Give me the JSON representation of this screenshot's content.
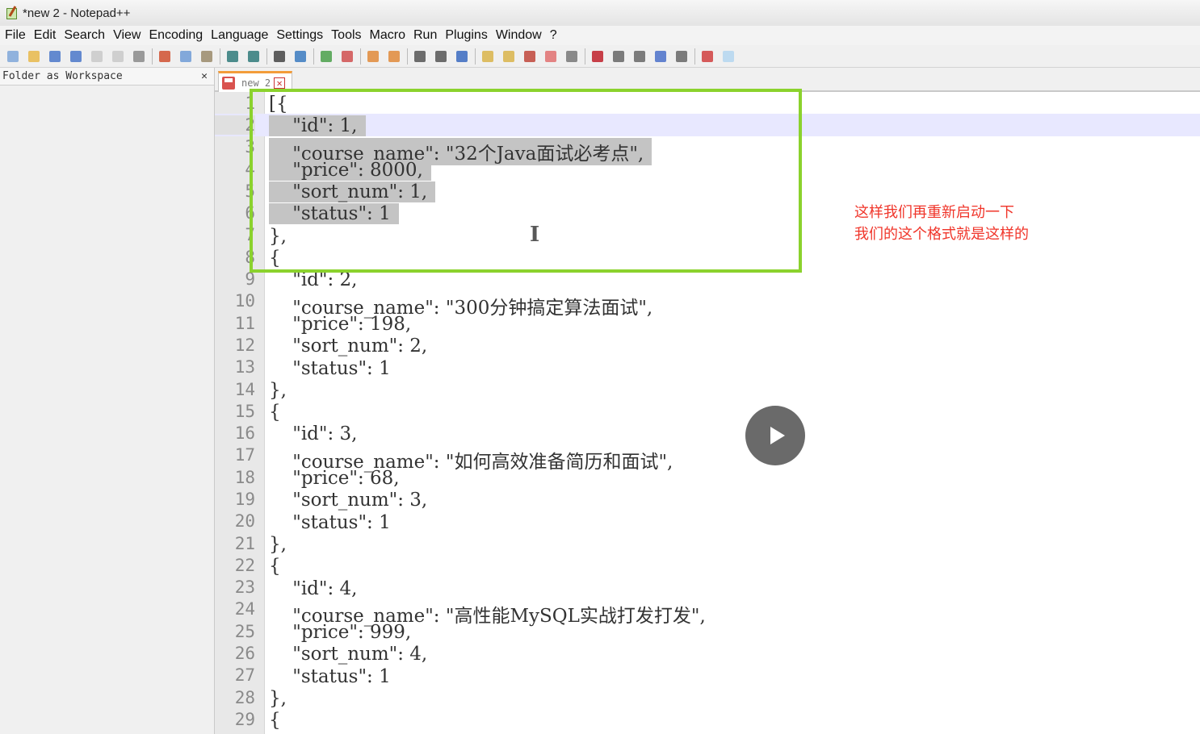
{
  "window": {
    "title": "*new 2 - Notepad++"
  },
  "menu": [
    "File",
    "Edit",
    "Search",
    "View",
    "Encoding",
    "Language",
    "Settings",
    "Tools",
    "Macro",
    "Run",
    "Plugins",
    "Window",
    "?"
  ],
  "toolbar": {
    "groups": [
      [
        "new-file-icon",
        "open-file-icon",
        "save-icon",
        "save-all-icon",
        "close-icon",
        "close-all-icon",
        "print-icon"
      ],
      [
        "cut-icon",
        "copy-icon",
        "paste-icon"
      ],
      [
        "undo-icon",
        "redo-icon"
      ],
      [
        "find-icon",
        "replace-icon"
      ],
      [
        "zoom-in-icon",
        "zoom-out-icon"
      ],
      [
        "sync-vertical-icon",
        "sync-horizontal-icon"
      ],
      [
        "word-wrap-icon",
        "show-all-chars-icon",
        "indent-guide-icon"
      ],
      [
        "user-language-icon",
        "doc-map-icon",
        "function-list-icon",
        "folder-workspace-icon",
        "monitor-icon"
      ],
      [
        "record-macro-icon",
        "stop-macro-icon",
        "play-macro-icon",
        "run-macro-multiple-icon",
        "save-macro-icon"
      ],
      [
        "spell-check-icon",
        "highlight-icon"
      ]
    ],
    "colors": [
      "#7fa7d9",
      "#e8b84a",
      "#4a77c9",
      "#4a77c9",
      "#c9c9c9",
      "#c9c9c9",
      "#8a8a8a",
      "#d05030",
      "#6f9bd6",
      "#9a8a6a",
      "#2f7a7a",
      "#2f7a7a",
      "#444444",
      "#3a7abf",
      "#4aa04a",
      "#d05050",
      "#e08a3a",
      "#e08a3a",
      "#555555",
      "#555555",
      "#3a6abf",
      "#d9b44a",
      "#d9b44a",
      "#c0453a",
      "#e07070",
      "#777777",
      "#c0202a",
      "#666666",
      "#666666",
      "#4a70c9",
      "#666666",
      "#d04040",
      "#b4d6f0"
    ]
  },
  "sidebar": {
    "title": "Folder as Workspace",
    "close": "✕"
  },
  "tab": {
    "label": "new 2",
    "close": "✕"
  },
  "editor": {
    "lines": [
      {
        "num": "1",
        "code": "[{",
        "sel": false
      },
      {
        "num": "2",
        "code": "    \"id\": 1,",
        "sel": true,
        "current": true
      },
      {
        "num": "3",
        "code": "    \"course_name\": \"32个Java面试必考点\",",
        "sel": true
      },
      {
        "num": "4",
        "code": "    \"price\": 8000,",
        "sel": true
      },
      {
        "num": "5",
        "code": "    \"sort_num\": 1,",
        "sel": true
      },
      {
        "num": "6",
        "code": "    \"status\": 1",
        "sel": true
      },
      {
        "num": "7",
        "code": "},",
        "sel": false
      },
      {
        "num": "8",
        "code": "{",
        "sel": false
      },
      {
        "num": "9",
        "code": "    \"id\": 2,",
        "sel": false
      },
      {
        "num": "10",
        "code": "    \"course_name\": \"300分钟搞定算法面试\",",
        "sel": false
      },
      {
        "num": "11",
        "code": "    \"price\": 198,",
        "sel": false
      },
      {
        "num": "12",
        "code": "    \"sort_num\": 2,",
        "sel": false
      },
      {
        "num": "13",
        "code": "    \"status\": 1",
        "sel": false
      },
      {
        "num": "14",
        "code": "},",
        "sel": false
      },
      {
        "num": "15",
        "code": "{",
        "sel": false
      },
      {
        "num": "16",
        "code": "    \"id\": 3,",
        "sel": false
      },
      {
        "num": "17",
        "code": "    \"course_name\": \"如何高效准备简历和面试\",",
        "sel": false
      },
      {
        "num": "18",
        "code": "    \"price\": 68,",
        "sel": false
      },
      {
        "num": "19",
        "code": "    \"sort_num\": 3,",
        "sel": false
      },
      {
        "num": "20",
        "code": "    \"status\": 1",
        "sel": false
      },
      {
        "num": "21",
        "code": "},",
        "sel": false
      },
      {
        "num": "22",
        "code": "{",
        "sel": false
      },
      {
        "num": "23",
        "code": "    \"id\": 4,",
        "sel": false
      },
      {
        "num": "24",
        "code": "    \"course_name\": \"高性能MySQL实战打发打发\",",
        "sel": false
      },
      {
        "num": "25",
        "code": "    \"price\": 999,",
        "sel": false
      },
      {
        "num": "26",
        "code": "    \"sort_num\": 4,",
        "sel": false
      },
      {
        "num": "27",
        "code": "    \"status\": 1",
        "sel": false
      },
      {
        "num": "28",
        "code": "},",
        "sel": false
      },
      {
        "num": "29",
        "code": "{",
        "sel": false
      }
    ]
  },
  "annotation": {
    "line1": "这样我们再重新启动一下",
    "line2": "我们的这个格式就是这样的"
  },
  "overlay": {
    "highlight_color": "#8bd22d",
    "annotation_color": "#f0352a"
  }
}
